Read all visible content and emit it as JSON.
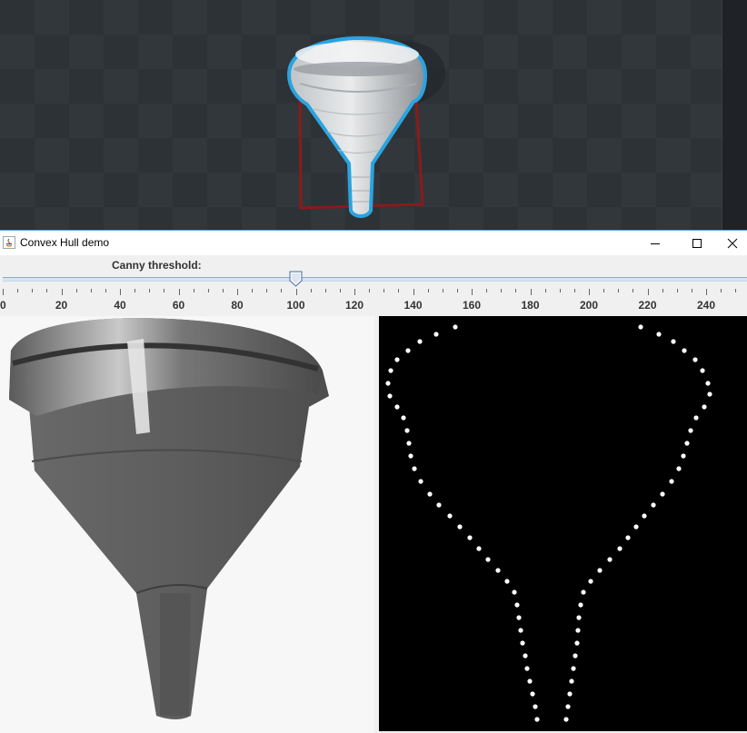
{
  "window": {
    "title": "Convex Hull demo",
    "controls": {
      "minimize": "minimize-icon",
      "maximize": "maximize-icon",
      "close": "close-icon"
    }
  },
  "slider": {
    "label": "Canny threshold:",
    "min": 0,
    "max": 255,
    "value": 100,
    "tick_labels": [
      "0",
      "20",
      "40",
      "60",
      "80",
      "100",
      "120",
      "140",
      "160",
      "180",
      "200",
      "220",
      "240"
    ]
  },
  "panels": {
    "source": "funnel-photo",
    "hull": "convex-hull-points"
  },
  "colors": {
    "hull_outline": "#2aa4e0",
    "bounding_box": "#8b1a1a",
    "hull_points": "#ffffff",
    "hull_background": "#000000"
  }
}
